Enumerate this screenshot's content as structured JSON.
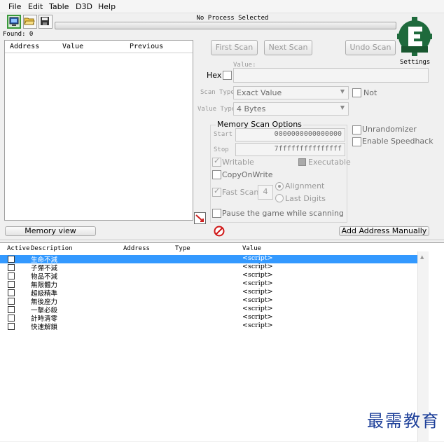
{
  "menu": [
    "File",
    "Edit",
    "Table",
    "D3D",
    "Help"
  ],
  "toolbar": {
    "process_title": "No Process Selected",
    "found_label": "Found: 0",
    "settings_label": "Settings"
  },
  "results": {
    "columns": [
      "Address",
      "Value",
      "Previous"
    ]
  },
  "scan": {
    "first_scan": "First Scan",
    "next_scan": "Next Scan",
    "undo_scan": "Undo Scan",
    "value_label": "Value:",
    "hex_label": "Hex",
    "scan_type_label": "Scan Type",
    "scan_type_value": "Exact Value",
    "value_type_label": "Value Type",
    "value_type_value": "4 Bytes",
    "not_label": "Not"
  },
  "memory_options": {
    "title": "Memory Scan Options",
    "start_label": "Start",
    "start_value": "0000000000000000",
    "stop_label": "Stop",
    "stop_value": "7fffffffffffffff",
    "writable": "Writable",
    "executable": "Executable",
    "copy_on_write": "CopyOnWrite",
    "fast_scan": "Fast Scan",
    "fast_scan_value": "4",
    "alignment": "Alignment",
    "last_digits": "Last Digits",
    "pause_game": "Pause the game while scanning",
    "unrandomizer": "Unrandomizer",
    "enable_speedhack": "Enable Speedhack"
  },
  "actions": {
    "memory_view": "Memory view",
    "add_address": "Add Address Manually"
  },
  "address_list": {
    "columns": [
      "Active",
      "Description",
      "Address",
      "Type",
      "Value"
    ],
    "rows": [
      {
        "description": "生命不減",
        "value": "<script>"
      },
      {
        "description": "子彈不減",
        "value": "<script>"
      },
      {
        "description": "物品不減",
        "value": "<script>"
      },
      {
        "description": "無限體力",
        "value": "<script>"
      },
      {
        "description": "超級精準",
        "value": "<script>"
      },
      {
        "description": "無後座力",
        "value": "<script>"
      },
      {
        "description": "一擊必殺",
        "value": "<script>"
      },
      {
        "description": "計時清零",
        "value": "<script>"
      },
      {
        "description": "快速解鎖",
        "value": "<script>"
      }
    ]
  },
  "watermark": "最需教育",
  "colors": {
    "selection": "#3399ff",
    "logo": "#1e6a3c",
    "watermark": "#1d3f99"
  }
}
